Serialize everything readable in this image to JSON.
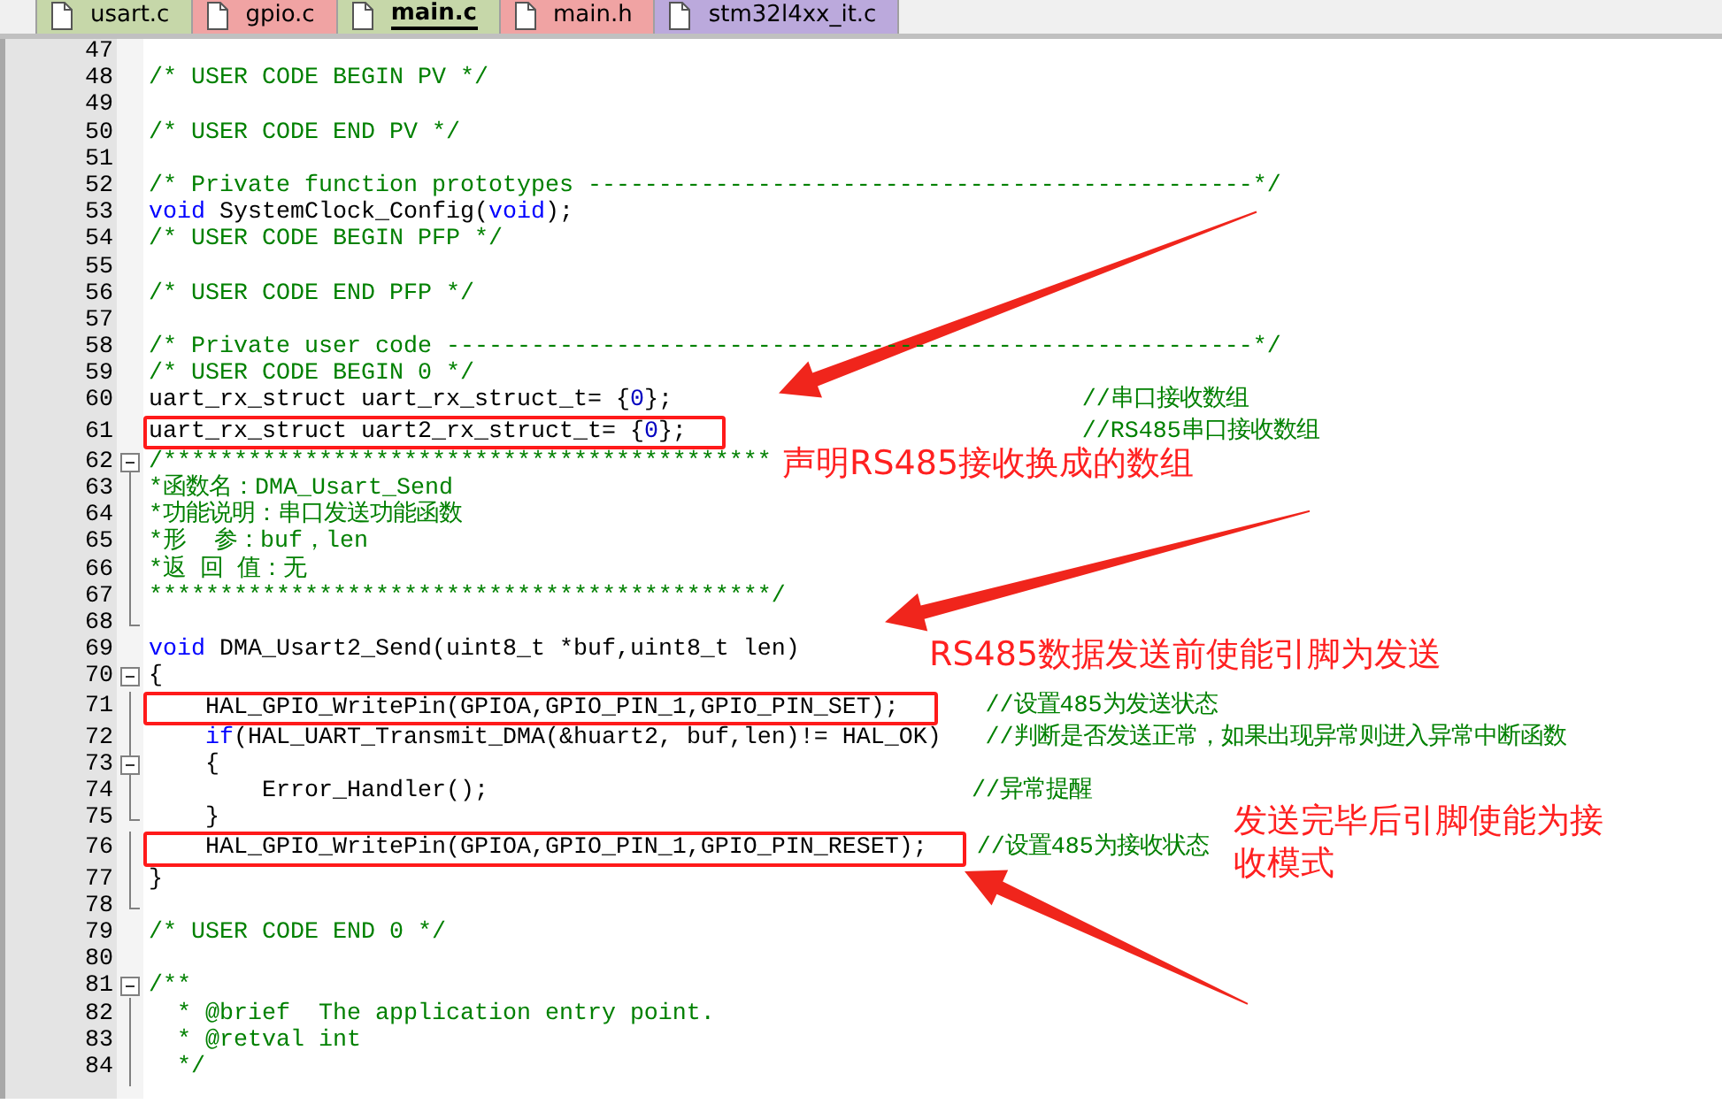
{
  "tabs": [
    {
      "label": "usart.c",
      "selected": false,
      "color": "#c6d7a9"
    },
    {
      "label": "gpio.c",
      "selected": false,
      "color": "#f0a3a3"
    },
    {
      "label": "main.c",
      "selected": true,
      "color": "#c6d7a9"
    },
    {
      "label": "main.h",
      "selected": false,
      "color": "#f0a3a3"
    },
    {
      "label": "stm32l4xx_it.c",
      "selected": false,
      "color": "#bba9dc"
    }
  ],
  "editor": {
    "lines": [
      {
        "number": "47"
      },
      {
        "number": "48",
        "segments": [
          {
            "kind": "comment",
            "text": "/* USER CODE BEGIN PV */"
          }
        ]
      },
      {
        "number": "49"
      },
      {
        "number": "50",
        "segments": [
          {
            "kind": "comment",
            "text": "/* USER CODE END PV */"
          }
        ]
      },
      {
        "number": "51"
      },
      {
        "number": "52",
        "segments": [
          {
            "kind": "comment",
            "text": "/* Private function prototypes -----------------------------------------------*/"
          }
        ]
      },
      {
        "number": "53",
        "segments": [
          {
            "kind": "keyword",
            "text": "void"
          },
          {
            "kind": "code",
            "text": " SystemClock_Config("
          },
          {
            "kind": "keyword",
            "text": "void"
          },
          {
            "kind": "code",
            "text": ");"
          }
        ]
      },
      {
        "number": "54",
        "segments": [
          {
            "kind": "comment",
            "text": "/* USER CODE BEGIN PFP */"
          }
        ]
      },
      {
        "number": "55"
      },
      {
        "number": "56",
        "segments": [
          {
            "kind": "comment",
            "text": "/* USER CODE END PFP */"
          }
        ]
      },
      {
        "number": "57"
      },
      {
        "number": "58",
        "segments": [
          {
            "kind": "comment",
            "text": "/* Private user code ---------------------------------------------------------*/"
          }
        ]
      },
      {
        "number": "59",
        "segments": [
          {
            "kind": "comment",
            "text": "/* USER CODE BEGIN 0 */"
          }
        ]
      },
      {
        "number": "60",
        "segments": [
          {
            "kind": "code",
            "text": "uart_rx_struct uart_rx_struct_t= {"
          },
          {
            "kind": "number",
            "text": "0"
          },
          {
            "kind": "code",
            "text": "};"
          }
        ],
        "comment": "//串口接收数组"
      },
      {
        "number": "61",
        "boxed": true,
        "segments": [
          {
            "kind": "code",
            "text": "uart_rx_struct uart2_rx_struct_t= {"
          },
          {
            "kind": "number",
            "text": "0"
          },
          {
            "kind": "code",
            "text": "};"
          }
        ],
        "comment": "//RS485串口接收数组"
      },
      {
        "number": "62",
        "kind": "foldstart",
        "segments": [
          {
            "kind": "comment",
            "text": "/*******************************************"
          }
        ]
      },
      {
        "number": "63",
        "kind": "foldbody",
        "segments": [
          {
            "kind": "comment",
            "text": "*函数名：DMA_Usart_Send"
          }
        ]
      },
      {
        "number": "64",
        "kind": "foldbody",
        "segments": [
          {
            "kind": "comment",
            "text": "*功能说明：串口发送功能函数"
          }
        ]
      },
      {
        "number": "65",
        "kind": "foldbody",
        "segments": [
          {
            "kind": "comment",
            "text": "*形  参：buf，len"
          }
        ]
      },
      {
        "number": "66",
        "kind": "foldbody",
        "segments": [
          {
            "kind": "comment",
            "text": "*返 回 值：无"
          }
        ]
      },
      {
        "number": "67",
        "kind": "foldbody",
        "segments": [
          {
            "kind": "comment",
            "text": "********************************************/"
          }
        ]
      },
      {
        "number": "68",
        "kind": "foldend"
      },
      {
        "number": "69",
        "segments": [
          {
            "kind": "keyword",
            "text": "void"
          },
          {
            "kind": "code",
            "text": " DMA_Usart2_Send(uint8_t *buf,uint8_t len)"
          }
        ]
      },
      {
        "number": "70",
        "kind": "foldstart",
        "segments": [
          {
            "kind": "code",
            "text": "{"
          }
        ]
      },
      {
        "number": "71",
        "kind": "foldbody",
        "boxed": true,
        "segments": [
          {
            "kind": "code",
            "text": "    HAL_GPIO_WritePin(GPIOA,GPIO_PIN_1,GPIO_PIN_SET);"
          }
        ],
        "comment": "//设置485为发送状态"
      },
      {
        "number": "72",
        "kind": "foldbody",
        "segments": [
          {
            "kind": "keyword",
            "text": "    if"
          },
          {
            "kind": "code",
            "text": "(HAL_UART_Transmit_DMA(&huart2, buf,len)!= HAL_OK)"
          }
        ],
        "comment": "//判断是否发送正常，如果出现异常则进入异常中断函数"
      },
      {
        "number": "73",
        "kind": "foldstart",
        "segments": [
          {
            "kind": "code",
            "text": "    {"
          }
        ]
      },
      {
        "number": "74",
        "kind": "foldbody",
        "segments": [
          {
            "kind": "code",
            "text": "        Error_Handler();"
          }
        ],
        "comment": "//异常提醒"
      },
      {
        "number": "75",
        "kind": "foldend",
        "segments": [
          {
            "kind": "code",
            "text": "    }"
          }
        ]
      },
      {
        "number": "76",
        "kind": "foldbody",
        "boxed": true,
        "segments": [
          {
            "kind": "code",
            "text": "    HAL_GPIO_WritePin(GPIOA,GPIO_PIN_1,GPIO_PIN_RESET);"
          }
        ],
        "comment": "//设置485为接收状态"
      },
      {
        "number": "77",
        "kind": "foldbody",
        "segments": [
          {
            "kind": "code",
            "text": "}"
          }
        ]
      },
      {
        "number": "78",
        "kind": "foldend"
      },
      {
        "number": "79",
        "segments": [
          {
            "kind": "comment",
            "text": "/* USER CODE END 0 */"
          }
        ]
      },
      {
        "number": "80"
      },
      {
        "number": "81",
        "kind": "foldstart",
        "segments": [
          {
            "kind": "comment",
            "text": "/**"
          }
        ]
      },
      {
        "number": "82",
        "kind": "foldbody",
        "segments": [
          {
            "kind": "comment",
            "text": "  * @brief  The application entry point."
          }
        ]
      },
      {
        "number": "83",
        "kind": "foldbody",
        "segments": [
          {
            "kind": "comment",
            "text": "  * @retval int"
          }
        ]
      },
      {
        "number": "84",
        "kind": "foldbody",
        "segments": [
          {
            "kind": "comment",
            "text": "  */"
          }
        ]
      }
    ]
  },
  "annotations": [
    {
      "text": "声明RS485接收换成的数组"
    },
    {
      "text": "RS485数据发送前使能引脚为发送"
    },
    {
      "text": "发送完毕后引脚使能为接收模式"
    }
  ]
}
